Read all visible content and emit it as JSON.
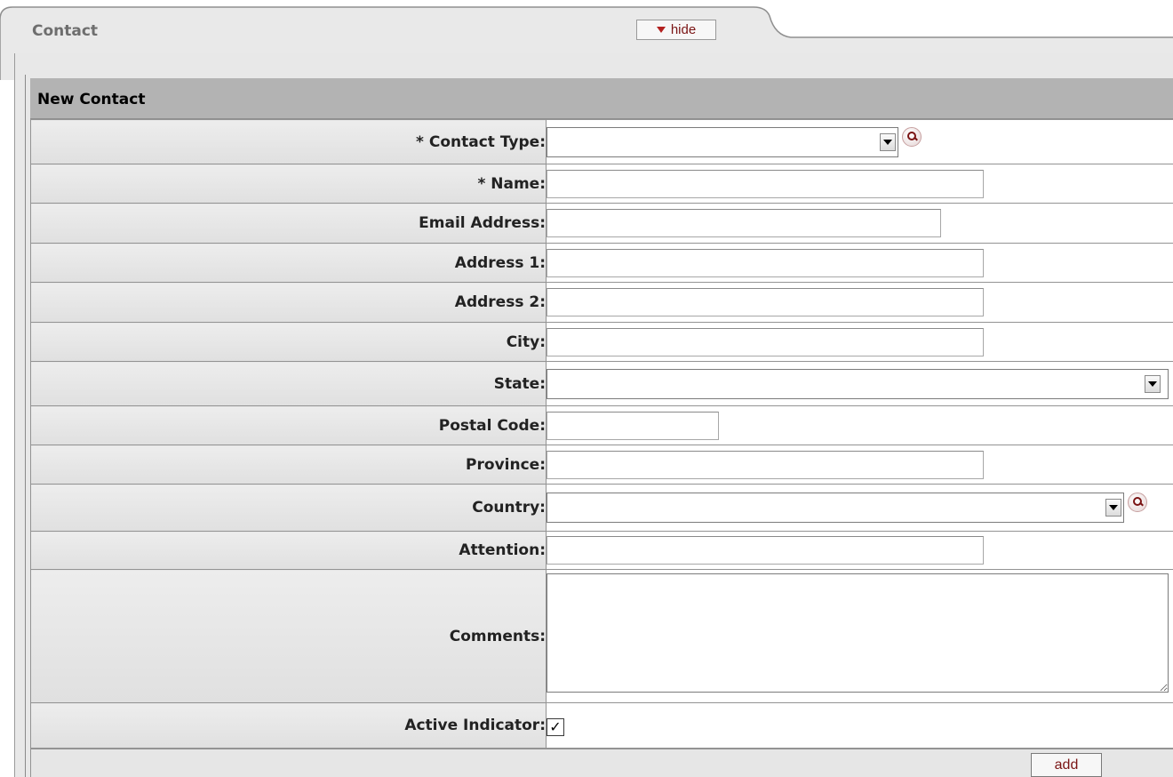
{
  "tab": {
    "title": "Contact",
    "hide_label": "hide"
  },
  "section": {
    "title": "New Contact"
  },
  "fields": {
    "contact_type": {
      "label": "*  Contact Type:",
      "value": ""
    },
    "name": {
      "label": "*  Name:",
      "value": ""
    },
    "email": {
      "label": "Email Address:",
      "value": ""
    },
    "address1": {
      "label": "Address 1:",
      "value": ""
    },
    "address2": {
      "label": "Address 2:",
      "value": ""
    },
    "city": {
      "label": "City:",
      "value": ""
    },
    "state": {
      "label": "State:",
      "value": ""
    },
    "postal_code": {
      "label": "Postal Code:",
      "value": ""
    },
    "province": {
      "label": "Province:",
      "value": ""
    },
    "country": {
      "label": "Country:",
      "value": ""
    },
    "attention": {
      "label": "Attention:",
      "value": ""
    },
    "comments": {
      "label": "Comments:",
      "value": ""
    },
    "active": {
      "label": "Active Indicator:",
      "checked": true,
      "check_glyph": "✓"
    }
  },
  "actions": {
    "add_label": "add"
  },
  "icons": {
    "lookup": "magnifier-lookup-icon",
    "dropdown": "chevron-down-icon"
  },
  "colors": {
    "header_bg": "#b3b3b3",
    "label_bg": "#e6e6e6",
    "button_text": "#7a1414"
  }
}
